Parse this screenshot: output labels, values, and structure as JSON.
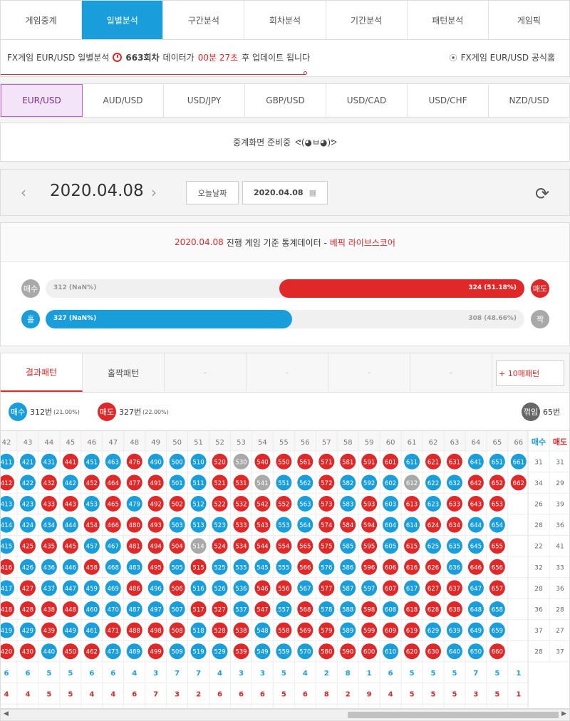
{
  "nav": {
    "items": [
      "게임중계",
      "일별분석",
      "구간분석",
      "회차분석",
      "기간분석",
      "패턴분석",
      "게임픽"
    ]
  },
  "info": {
    "prefix": "FX게임 EUR/USD 일별분석",
    "round": "663회차",
    "mid": "데이터가",
    "time": "00분 27초",
    "suffix": "후 업데이트 됩니다",
    "official": "FX게임 EUR/USD 공식홈"
  },
  "pairs": [
    "EUR/USD",
    "AUD/USD",
    "USD/JPY",
    "GBP/USD",
    "USD/CAD",
    "USD/CHF",
    "NZD/USD"
  ],
  "prep": {
    "text": "중계화면 준비중",
    "emoji": "ᕙ(◕ㅂ◕)ᕗ"
  },
  "date": {
    "current": "2020.04.08",
    "today_label": "오늘날짜",
    "picker_value": "2020.04.08"
  },
  "stats": {
    "head_date": "2020.04.08",
    "head_mid": "진행 게임 기준 통계데이터 -",
    "head_brand": "베픽 라이브스코어",
    "buy": {
      "label": "매수",
      "text": "312 (NaN%)"
    },
    "sell": {
      "label": "매도",
      "text": "324 (51.18%)",
      "fraction": 0.5118
    },
    "odd": {
      "label": "홀",
      "text": "327 (NaN%)",
      "fraction": 0.515
    },
    "even": {
      "label": "짝",
      "text": "308 (48.66%)"
    }
  },
  "pattern_tabs": [
    "결과패턴",
    "홀짝패턴",
    "-",
    "-",
    "-",
    "-"
  ],
  "plus_button": "+ 10매패턴",
  "legend": {
    "buy_label": "매수",
    "buy_count": "312번",
    "buy_pct": "(21.00%)",
    "sell_label": "매도",
    "sell_count": "327번",
    "sell_pct": "(22.00%)",
    "flip_label": "꺾임",
    "flip_count": "65번"
  },
  "grid": {
    "columns": [
      "42",
      "43",
      "44",
      "45",
      "46",
      "47",
      "48",
      "49",
      "50",
      "51",
      "52",
      "53",
      "54",
      "55",
      "56",
      "57",
      "58",
      "59",
      "60",
      "61",
      "62",
      "63",
      "64",
      "65",
      "66"
    ],
    "col_cells": [
      [
        [
          "411",
          "b"
        ],
        [
          "412",
          "r"
        ],
        [
          "413",
          "b"
        ],
        [
          "414",
          "b"
        ],
        [
          "415",
          "b"
        ],
        [
          "416",
          "r"
        ],
        [
          "417",
          "b"
        ],
        [
          "418",
          "r"
        ],
        [
          "419",
          "b"
        ],
        [
          "420",
          "r"
        ]
      ],
      [
        [
          "421",
          "b"
        ],
        [
          "422",
          "b"
        ],
        [
          "423",
          "b"
        ],
        [
          "424",
          "b"
        ],
        [
          "425",
          "r"
        ],
        [
          "426",
          "b"
        ],
        [
          "427",
          "r"
        ],
        [
          "428",
          "r"
        ],
        [
          "429",
          "b"
        ],
        [
          "430",
          "r"
        ]
      ],
      [
        [
          "431",
          "b"
        ],
        [
          "432",
          "r"
        ],
        [
          "433",
          "r"
        ],
        [
          "434",
          "b"
        ],
        [
          "435",
          "r"
        ],
        [
          "436",
          "b"
        ],
        [
          "437",
          "b"
        ],
        [
          "438",
          "r"
        ],
        [
          "439",
          "r"
        ],
        [
          "440",
          "b"
        ]
      ],
      [
        [
          "441",
          "r"
        ],
        [
          "442",
          "b"
        ],
        [
          "443",
          "r"
        ],
        [
          "444",
          "b"
        ],
        [
          "445",
          "r"
        ],
        [
          "446",
          "b"
        ],
        [
          "447",
          "b"
        ],
        [
          "448",
          "r"
        ],
        [
          "449",
          "b"
        ],
        [
          "450",
          "r"
        ]
      ],
      [
        [
          "451",
          "b"
        ],
        [
          "452",
          "r"
        ],
        [
          "453",
          "b"
        ],
        [
          "454",
          "r"
        ],
        [
          "457",
          "b"
        ],
        [
          "458",
          "r"
        ],
        [
          "459",
          "b"
        ],
        [
          "460",
          "b"
        ],
        [
          "461",
          "b"
        ],
        [
          "462",
          "r"
        ]
      ],
      [
        [
          "463",
          "b"
        ],
        [
          "464",
          "r"
        ],
        [
          "465",
          "r"
        ],
        [
          "466",
          "r"
        ],
        [
          "467",
          "b"
        ],
        [
          "468",
          "b"
        ],
        [
          "469",
          "b"
        ],
        [
          "470",
          "b"
        ],
        [
          "471",
          "r"
        ],
        [
          "473",
          "b"
        ]
      ],
      [
        [
          "476",
          "r"
        ],
        [
          "477",
          "r"
        ],
        [
          "479",
          "b"
        ],
        [
          "480",
          "r"
        ],
        [
          "481",
          "r"
        ],
        [
          "483",
          "b"
        ],
        [
          "486",
          "r"
        ],
        [
          "487",
          "b"
        ],
        [
          "488",
          "r"
        ],
        [
          "489",
          "b"
        ]
      ],
      [
        [
          "490",
          "b"
        ],
        [
          "491",
          "r"
        ],
        [
          "492",
          "r"
        ],
        [
          "493",
          "r"
        ],
        [
          "494",
          "r"
        ],
        [
          "495",
          "r"
        ],
        [
          "496",
          "b"
        ],
        [
          "497",
          "b"
        ],
        [
          "498",
          "r"
        ],
        [
          "499",
          "r"
        ]
      ],
      [
        [
          "500",
          "b"
        ],
        [
          "501",
          "b"
        ],
        [
          "502",
          "r"
        ],
        [
          "503",
          "b"
        ],
        [
          "504",
          "r"
        ],
        [
          "505",
          "b"
        ],
        [
          "506",
          "r"
        ],
        [
          "507",
          "b"
        ],
        [
          "508",
          "r"
        ],
        [
          "509",
          "b"
        ]
      ],
      [
        [
          "510",
          "b"
        ],
        [
          "511",
          "b"
        ],
        [
          "512",
          "b"
        ],
        [
          "513",
          "b"
        ],
        [
          "514",
          "g"
        ],
        [
          "515",
          "r"
        ],
        [
          "516",
          "b"
        ],
        [
          "517",
          "r"
        ],
        [
          "518",
          "b"
        ],
        [
          "519",
          "b"
        ]
      ],
      [
        [
          "520",
          "r"
        ],
        [
          "521",
          "r"
        ],
        [
          "522",
          "r"
        ],
        [
          "523",
          "b"
        ],
        [
          "524",
          "r"
        ],
        [
          "525",
          "b"
        ],
        [
          "526",
          "b"
        ],
        [
          "527",
          "r"
        ],
        [
          "528",
          "r"
        ],
        [
          "529",
          "b"
        ]
      ],
      [
        [
          "530",
          "g"
        ],
        [
          "531",
          "r"
        ],
        [
          "532",
          "r"
        ],
        [
          "533",
          "r"
        ],
        [
          "534",
          "r"
        ],
        [
          "535",
          "b"
        ],
        [
          "536",
          "b"
        ],
        [
          "537",
          "b"
        ],
        [
          "538",
          "r"
        ],
        [
          "539",
          "r"
        ]
      ],
      [
        [
          "540",
          "r"
        ],
        [
          "541",
          "g"
        ],
        [
          "542",
          "r"
        ],
        [
          "543",
          "r"
        ],
        [
          "544",
          "r"
        ],
        [
          "545",
          "b"
        ],
        [
          "546",
          "r"
        ],
        [
          "547",
          "r"
        ],
        [
          "548",
          "b"
        ],
        [
          "549",
          "b"
        ]
      ],
      [
        [
          "550",
          "r"
        ],
        [
          "551",
          "b"
        ],
        [
          "552",
          "r"
        ],
        [
          "553",
          "b"
        ],
        [
          "554",
          "r"
        ],
        [
          "555",
          "b"
        ],
        [
          "556",
          "r"
        ],
        [
          "557",
          "b"
        ],
        [
          "558",
          "r"
        ],
        [
          "559",
          "b"
        ]
      ],
      [
        [
          "561",
          "r"
        ],
        [
          "562",
          "b"
        ],
        [
          "563",
          "b"
        ],
        [
          "564",
          "b"
        ],
        [
          "565",
          "r"
        ],
        [
          "566",
          "r"
        ],
        [
          "567",
          "b"
        ],
        [
          "568",
          "r"
        ],
        [
          "569",
          "r"
        ],
        [
          "570",
          "b"
        ]
      ],
      [
        [
          "571",
          "r"
        ],
        [
          "572",
          "r"
        ],
        [
          "573",
          "r"
        ],
        [
          "574",
          "r"
        ],
        [
          "575",
          "r"
        ],
        [
          "576",
          "b"
        ],
        [
          "577",
          "r"
        ],
        [
          "578",
          "b"
        ],
        [
          "579",
          "r"
        ],
        [
          "580",
          "r"
        ]
      ],
      [
        [
          "581",
          "r"
        ],
        [
          "582",
          "b"
        ],
        [
          "583",
          "b"
        ],
        [
          "584",
          "r"
        ],
        [
          "585",
          "b"
        ],
        [
          "586",
          "b"
        ],
        [
          "587",
          "b"
        ],
        [
          "588",
          "b"
        ],
        [
          "589",
          "b"
        ],
        [
          "590",
          "r"
        ]
      ],
      [
        [
          "591",
          "r"
        ],
        [
          "592",
          "b"
        ],
        [
          "593",
          "r"
        ],
        [
          "594",
          "r"
        ],
        [
          "595",
          "r"
        ],
        [
          "596",
          "r"
        ],
        [
          "597",
          "b"
        ],
        [
          "598",
          "r"
        ],
        [
          "599",
          "r"
        ],
        [
          "600",
          "r"
        ]
      ],
      [
        [
          "601",
          "r"
        ],
        [
          "602",
          "b"
        ],
        [
          "603",
          "b"
        ],
        [
          "604",
          "b"
        ],
        [
          "605",
          "b"
        ],
        [
          "606",
          "r"
        ],
        [
          "607",
          "r"
        ],
        [
          "608",
          "b"
        ],
        [
          "609",
          "r"
        ],
        [
          "610",
          "b"
        ]
      ],
      [
        [
          "611",
          "b"
        ],
        [
          "612",
          "g"
        ],
        [
          "613",
          "r"
        ],
        [
          "614",
          "b"
        ],
        [
          "615",
          "r"
        ],
        [
          "616",
          "r"
        ],
        [
          "617",
          "b"
        ],
        [
          "618",
          "r"
        ],
        [
          "619",
          "r"
        ],
        [
          "620",
          "r"
        ]
      ],
      [
        [
          "621",
          "r"
        ],
        [
          "622",
          "b"
        ],
        [
          "623",
          "b"
        ],
        [
          "624",
          "r"
        ],
        [
          "625",
          "b"
        ],
        [
          "626",
          "r"
        ],
        [
          "627",
          "r"
        ],
        [
          "628",
          "r"
        ],
        [
          "629",
          "b"
        ],
        [
          "630",
          "r"
        ]
      ],
      [
        [
          "631",
          "r"
        ],
        [
          "632",
          "b"
        ],
        [
          "633",
          "r"
        ],
        [
          "634",
          "r"
        ],
        [
          "635",
          "b"
        ],
        [
          "636",
          "b"
        ],
        [
          "637",
          "r"
        ],
        [
          "638",
          "r"
        ],
        [
          "639",
          "b"
        ],
        [
          "640",
          "b"
        ]
      ],
      [
        [
          "641",
          "b"
        ],
        [
          "642",
          "r"
        ],
        [
          "643",
          "r"
        ],
        [
          "644",
          "b"
        ],
        [
          "645",
          "b"
        ],
        [
          "646",
          "r"
        ],
        [
          "647",
          "b"
        ],
        [
          "648",
          "b"
        ],
        [
          "649",
          "b"
        ],
        [
          "650",
          "b"
        ]
      ],
      [
        [
          "651",
          "b"
        ],
        [
          "652",
          "r"
        ],
        [
          "653",
          "r"
        ],
        [
          "654",
          "b"
        ],
        [
          "655",
          "r"
        ],
        [
          "656",
          "r"
        ],
        [
          "657",
          "r"
        ],
        [
          "658",
          "b"
        ],
        [
          "659",
          "b"
        ],
        [
          "660",
          "r"
        ]
      ],
      [
        [
          "661",
          "b"
        ],
        [
          "662",
          "r"
        ]
      ]
    ],
    "buy_counts": [
      "6",
      "6",
      "5",
      "5",
      "6",
      "6",
      "4",
      "3",
      "7",
      "7",
      "4",
      "3",
      "3",
      "5",
      "4",
      "2",
      "8",
      "1",
      "6",
      "5",
      "5",
      "5",
      "7",
      "5",
      "1"
    ],
    "sell_counts": [
      "4",
      "4",
      "5",
      "5",
      "4",
      "4",
      "6",
      "7",
      "3",
      "2",
      "6",
      "6",
      "6",
      "5",
      "6",
      "8",
      "2",
      "9",
      "4",
      "5",
      "5",
      "5",
      "3",
      "5",
      "1"
    ],
    "side_headers": {
      "buy": "매수",
      "sell": "매도"
    },
    "side_rows": [
      [
        "31",
        "31"
      ],
      [
        "34",
        "29"
      ],
      [
        "26",
        "39"
      ],
      [
        "28",
        "36"
      ],
      [
        "22",
        "41"
      ],
      [
        "32",
        "33"
      ],
      [
        "28",
        "36"
      ],
      [
        "36",
        "28"
      ],
      [
        "37",
        "27"
      ],
      [
        "28",
        "37"
      ]
    ]
  },
  "colors": {
    "buy": "#1a9edb",
    "sell": "#e02828",
    "neutral": "#a9a9a9",
    "accent": "#1a9edb"
  }
}
